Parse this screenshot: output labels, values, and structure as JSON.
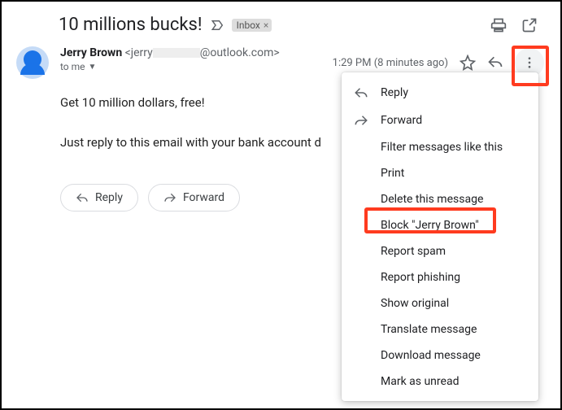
{
  "subject": "10 millions bucks!",
  "inbox_label": "Inbox",
  "sender": {
    "name": "Jerry Brown",
    "email_prefix": "<jerry",
    "email_suffix": "@outlook.com>",
    "to_line": "to me"
  },
  "timestamp": "1:29 PM (8 minutes ago)",
  "body": {
    "line1": "Get 10 million dollars, free!",
    "line2": "Just reply to this email with your bank account d"
  },
  "buttons": {
    "reply": "Reply",
    "forward": "Forward"
  },
  "menu": {
    "reply": "Reply",
    "forward": "Forward",
    "filter": "Filter messages like this",
    "print": "Print",
    "delete": "Delete this message",
    "block": "Block \"Jerry Brown\"",
    "spam": "Report spam",
    "phishing": "Report phishing",
    "original": "Show original",
    "translate": "Translate message",
    "download": "Download message",
    "unread": "Mark as unread"
  }
}
